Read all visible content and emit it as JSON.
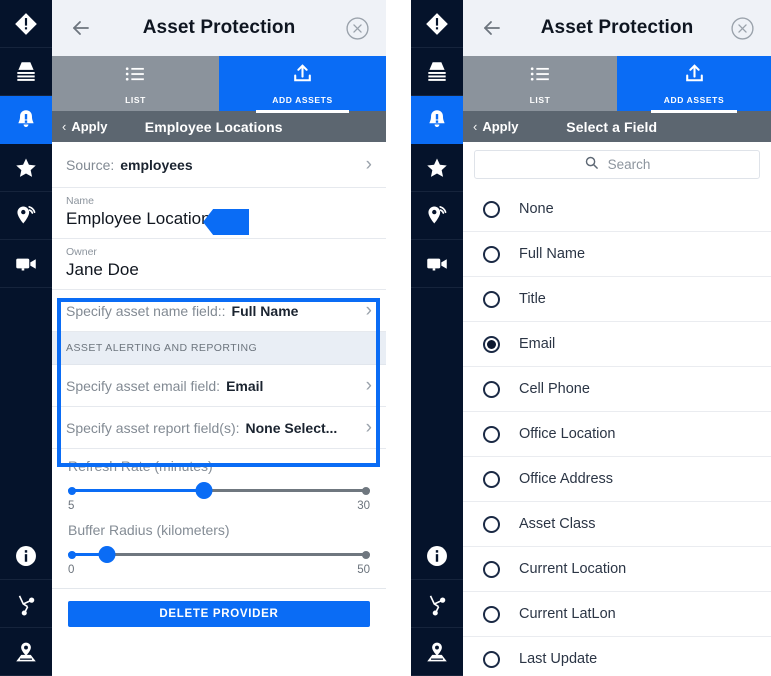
{
  "rail": {
    "items": [
      {
        "name": "alert-diamond-icon",
        "active": false
      },
      {
        "name": "database-stack-icon",
        "active": false
      },
      {
        "name": "bell-alert-icon",
        "active": true
      },
      {
        "name": "star-icon",
        "active": false
      },
      {
        "name": "location-signal-icon",
        "active": false
      },
      {
        "name": "video-camera-icon",
        "active": false
      }
    ],
    "bottom_items": [
      {
        "name": "info-icon"
      },
      {
        "name": "network-route-icon"
      },
      {
        "name": "map-pin-icon"
      }
    ]
  },
  "header": {
    "title": "Asset Protection",
    "back_icon": "arrow-left-icon",
    "close_icon": "close-circle-icon"
  },
  "tabs": [
    {
      "label": "LIST",
      "icon": "list-icon",
      "active": false
    },
    {
      "label": "ADD ASSETS",
      "icon": "upload-icon",
      "active": true
    }
  ],
  "left_panel": {
    "applybar": {
      "back_label": "Apply",
      "chevron": "‹",
      "subtitle": "Employee Locations"
    },
    "source_row": {
      "label": "Source:",
      "value": "employees",
      "chevron": "›"
    },
    "name_field": {
      "label": "Name",
      "value": "Employee Locations"
    },
    "owner_field": {
      "label": "Owner",
      "value": "Jane Doe"
    },
    "asset_name_row": {
      "label": "Specify asset name field::",
      "value": "Full Name",
      "chevron": "›"
    },
    "section_heading": "ASSET ALERTING AND REPORTING",
    "asset_email_row": {
      "label": "Specify asset email field:",
      "value": "Email",
      "chevron": "›"
    },
    "asset_report_row": {
      "label": "Specify asset report field(s):",
      "value": "None Select...",
      "chevron": "›"
    },
    "sliders": [
      {
        "title": "Refresh Rate (minutes)",
        "min_label": "5",
        "max_label": "30",
        "position_pct": 45
      },
      {
        "title": "Buffer Radius (kilometers)",
        "min_label": "0",
        "max_label": "50",
        "position_pct": 13
      }
    ],
    "delete_button": "DELETE PROVIDER"
  },
  "right_panel": {
    "applybar": {
      "back_label": "Apply",
      "chevron": "‹",
      "subtitle": "Select a Field"
    },
    "search": {
      "placeholder": "Search",
      "value": "",
      "icon": "search-icon"
    },
    "options": [
      {
        "label": "None",
        "selected": false
      },
      {
        "label": "Full Name",
        "selected": false
      },
      {
        "label": "Title",
        "selected": false
      },
      {
        "label": "Email",
        "selected": true
      },
      {
        "label": "Cell Phone",
        "selected": false
      },
      {
        "label": "Office Location",
        "selected": false
      },
      {
        "label": "Office Address",
        "selected": false
      },
      {
        "label": "Asset Class",
        "selected": false
      },
      {
        "label": "Current Location",
        "selected": false
      },
      {
        "label": "Current LatLon",
        "selected": false
      },
      {
        "label": "Last Update",
        "selected": false
      }
    ]
  },
  "colors": {
    "accent_blue": "#0a6cf5",
    "rail_navy": "#05132b",
    "applybar_gray": "#5c6670",
    "tab_inactive_gray": "#8b939c",
    "header_bg": "#eff2f7"
  }
}
